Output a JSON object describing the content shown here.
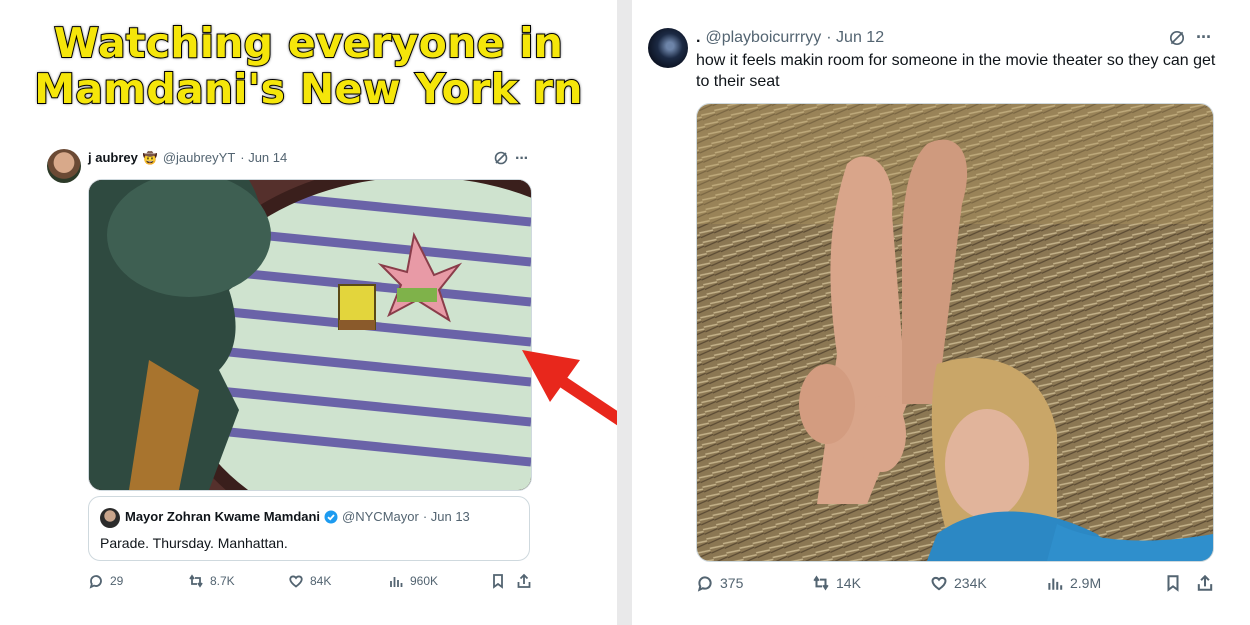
{
  "headline": {
    "line1": "Watching everyone in",
    "line2": "Mamdani's New York rn"
  },
  "left_tweet": {
    "display_name": "j aubrey",
    "handle": "@jaubreyYT",
    "date": "· Jun 14",
    "quoted": {
      "display_name": "Mayor Zohran Kwame Mamdani",
      "handle": "@NYCMayor",
      "date": "· Jun 13",
      "text": "Parade. Thursday. Manhattan."
    },
    "stats": {
      "replies": "29",
      "reposts": "8.7K",
      "likes": "84K",
      "views": "960K"
    },
    "image_description": "Squidward looking out window at SpongeBob and Patrick parading"
  },
  "right_tweet": {
    "display_name": ".",
    "handle": "@playboicurrryy",
    "date": "· Jun 12",
    "text": "how it feels makin room for someone in the movie theater so they can get to their seat",
    "stats": {
      "replies": "375",
      "reposts": "14K",
      "likes": "234K",
      "views": "2.9M"
    },
    "image_description": "woman lying in hay holding her legs straight up"
  },
  "colors": {
    "headline_fill": "#f5e60a",
    "arrow": "#e8271c",
    "verified": "#1d9bf0",
    "muted": "#536471"
  }
}
